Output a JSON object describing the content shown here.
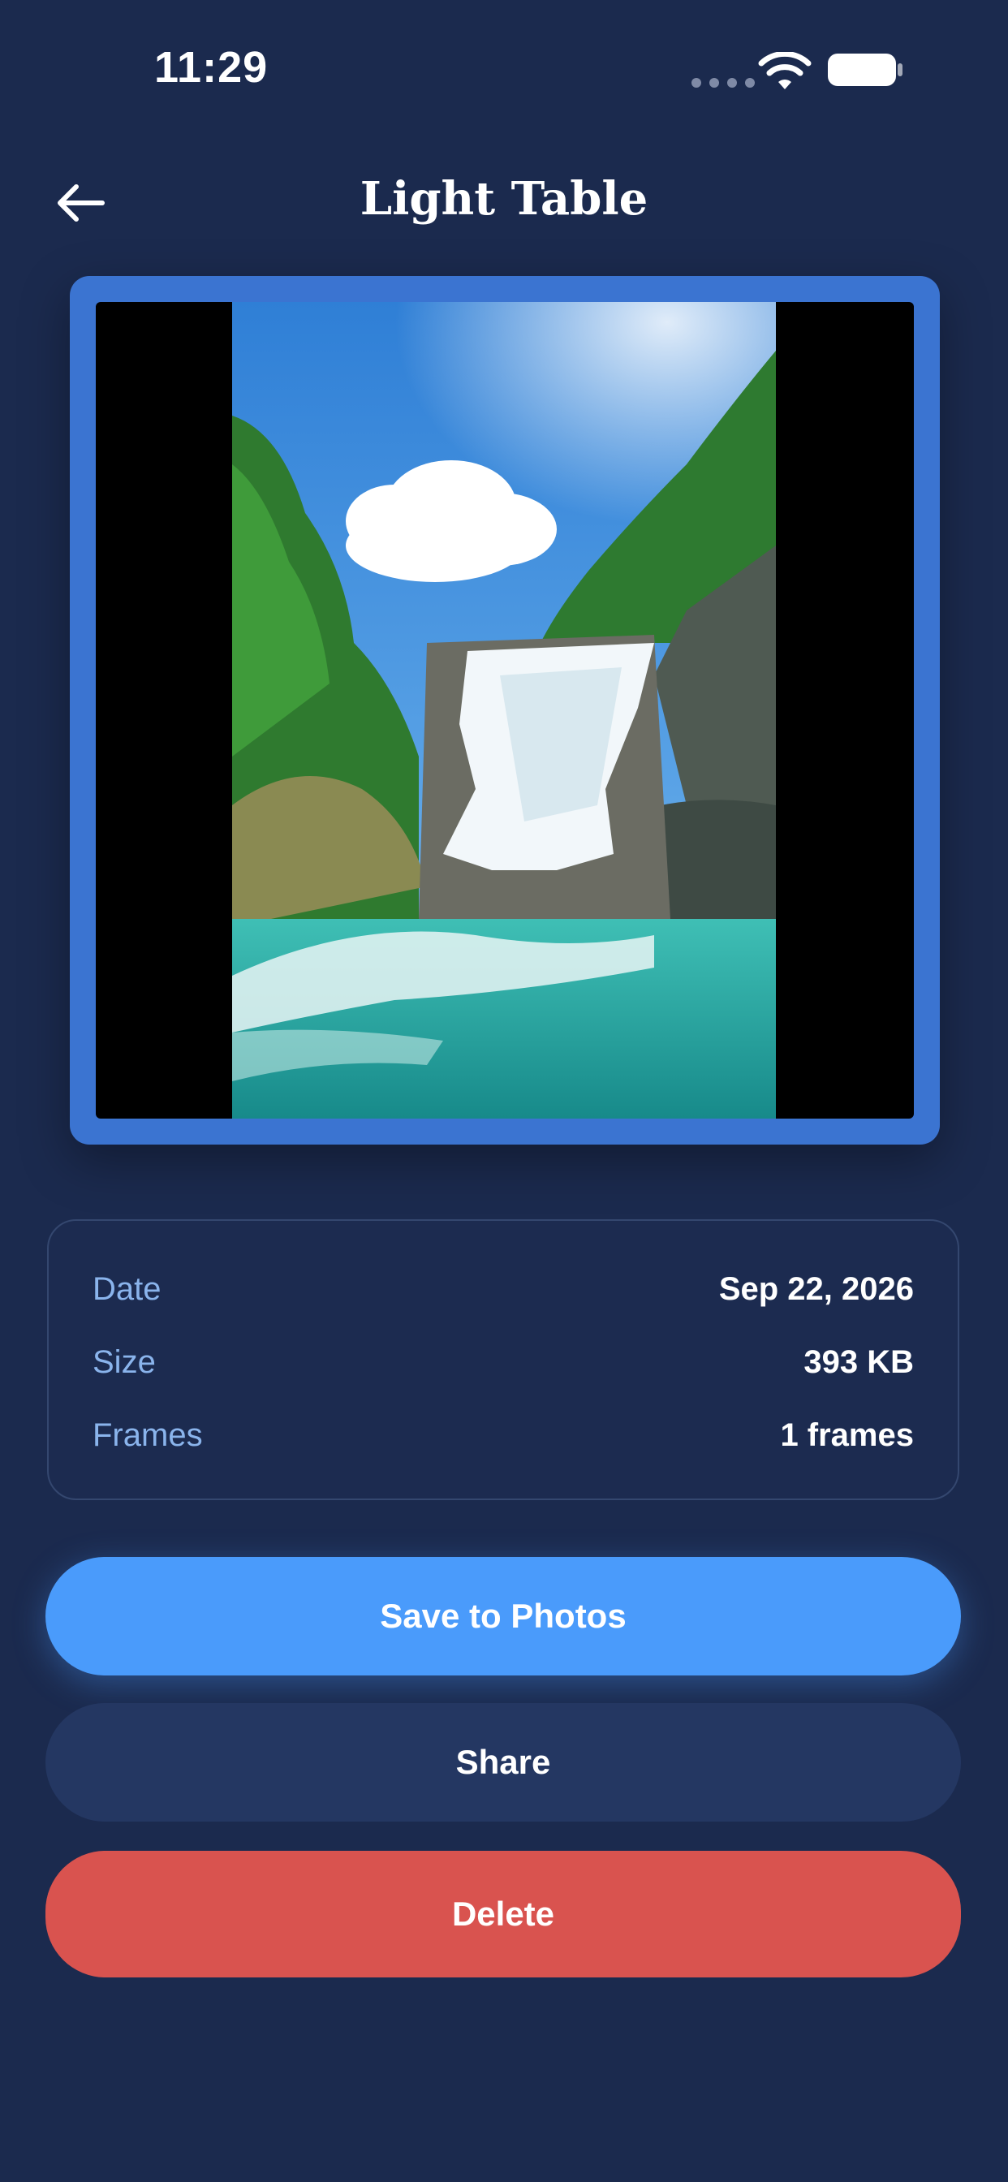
{
  "status_bar": {
    "time": "11:29"
  },
  "header": {
    "title": "Light Table",
    "back_icon": "arrow-left-icon"
  },
  "preview": {
    "description_icon": "waterfall-photo"
  },
  "info": {
    "rows": [
      {
        "label": "Date",
        "value": "Sep 22, 2026"
      },
      {
        "label": "Size",
        "value": "393 KB"
      },
      {
        "label": "Frames",
        "value": "1 frames"
      }
    ]
  },
  "actions": {
    "save_label": "Save to Photos",
    "share_label": "Share",
    "delete_label": "Delete"
  },
  "colors": {
    "background": "#1b2a4e",
    "frame_accent": "#3b74d1",
    "save": "#4a9bfb",
    "share": "#243762",
    "delete": "#d9534f",
    "label": "#8ab4ec"
  }
}
